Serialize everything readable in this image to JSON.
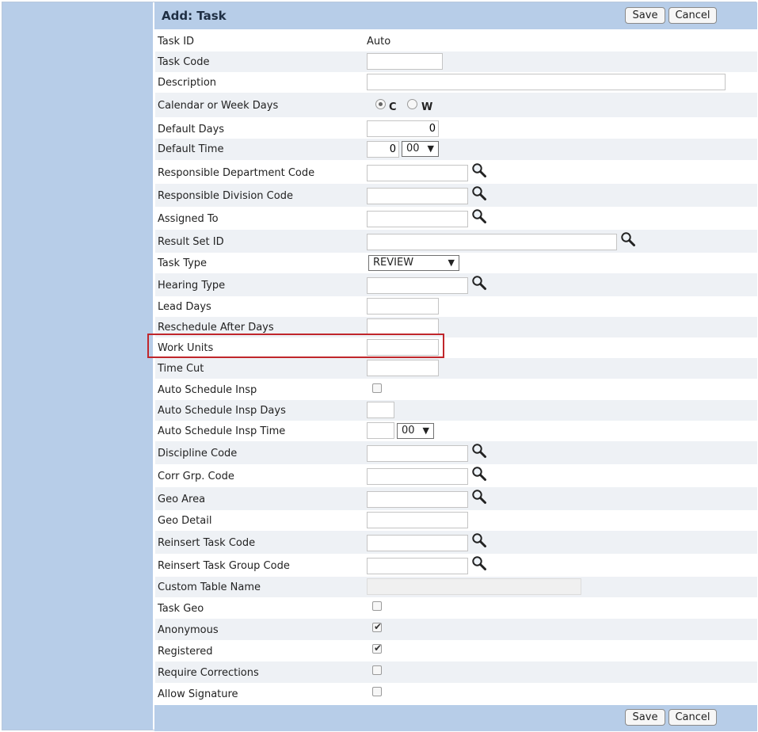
{
  "form": {
    "title": "Add: Task",
    "save_label": "Save",
    "cancel_label": "Cancel"
  },
  "fields": {
    "task_id": {
      "label": "Task ID",
      "value": "Auto"
    },
    "task_code": {
      "label": "Task Code",
      "value": ""
    },
    "description": {
      "label": "Description",
      "value": ""
    },
    "calendar_or_week_days": {
      "label": "Calendar or Week Days",
      "option_c": "C",
      "option_w": "W",
      "selected": "C"
    },
    "default_days": {
      "label": "Default Days",
      "value": "0"
    },
    "default_time": {
      "label": "Default Time",
      "hour": "0",
      "minute": "00"
    },
    "responsible_department_code": {
      "label": "Responsible Department Code",
      "value": ""
    },
    "responsible_division_code": {
      "label": "Responsible Division Code",
      "value": ""
    },
    "assigned_to": {
      "label": "Assigned To",
      "value": ""
    },
    "result_set_id": {
      "label": "Result Set ID",
      "value": ""
    },
    "task_type": {
      "label": "Task Type",
      "value": "REVIEW"
    },
    "hearing_type": {
      "label": "Hearing Type",
      "value": ""
    },
    "lead_days": {
      "label": "Lead Days",
      "value": ""
    },
    "reschedule_after_days": {
      "label": "Reschedule After Days",
      "value": ""
    },
    "work_units": {
      "label": "Work Units",
      "value": ""
    },
    "time_cut": {
      "label": "Time Cut",
      "value": ""
    },
    "auto_schedule_insp": {
      "label": "Auto Schedule Insp",
      "checked": false
    },
    "auto_schedule_insp_days": {
      "label": "Auto Schedule Insp Days",
      "value": ""
    },
    "auto_schedule_insp_time": {
      "label": "Auto Schedule Insp Time",
      "hour": "",
      "minute": "00"
    },
    "discipline_code": {
      "label": "Discipline Code",
      "value": ""
    },
    "corr_grp_code": {
      "label": "Corr Grp. Code",
      "value": ""
    },
    "geo_area": {
      "label": "Geo Area",
      "value": ""
    },
    "geo_detail": {
      "label": "Geo Detail",
      "value": ""
    },
    "reinsert_task_code": {
      "label": "Reinsert Task Code",
      "value": ""
    },
    "reinsert_task_group_code": {
      "label": "Reinsert Task Group Code",
      "value": ""
    },
    "custom_table_name": {
      "label": "Custom Table Name",
      "value": ""
    },
    "task_geo": {
      "label": "Task Geo",
      "checked": false
    },
    "anonymous": {
      "label": "Anonymous",
      "checked": true
    },
    "registered": {
      "label": "Registered",
      "checked": true
    },
    "require_corrections": {
      "label": "Require Corrections",
      "checked": false
    },
    "allow_signature": {
      "label": "Allow Signature",
      "checked": false
    }
  },
  "icons": {
    "lookup": "magnifier-icon",
    "check": "checkmark-icon",
    "dropdown": "triangle-down-icon"
  },
  "colors": {
    "header_bg": "#b7cde8",
    "row_alt_bg": "#eef1f5",
    "highlight_border": "#c0262b"
  }
}
